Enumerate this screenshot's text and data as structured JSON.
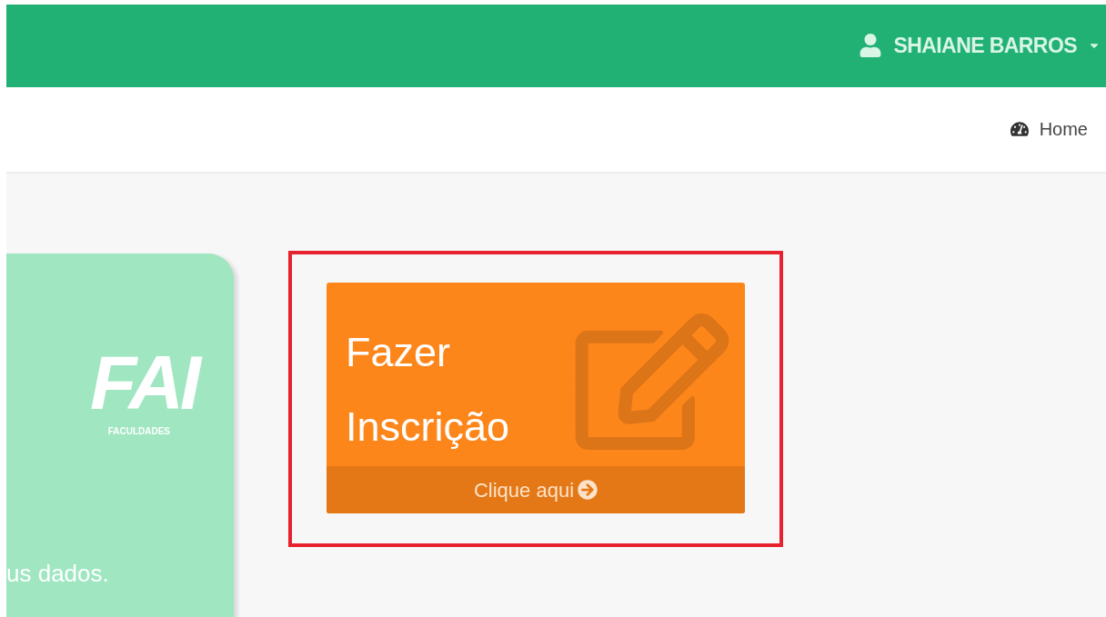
{
  "top_bar": {
    "user_name": "SHAIANE BARROS"
  },
  "breadcrumb": {
    "label": "Home"
  },
  "logo_card": {
    "logo_text": "FAI",
    "logo_subtitle": "FACULDADES",
    "text": "us dados."
  },
  "action_card": {
    "title_lines": [
      "Fazer",
      "Inscrição"
    ],
    "footer": "Clique aqui"
  }
}
